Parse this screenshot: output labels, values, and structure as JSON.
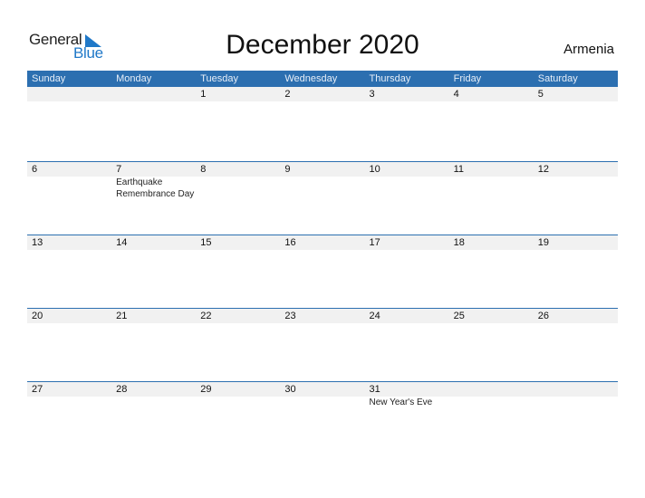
{
  "logo": {
    "word1": "General",
    "word2": "Blue"
  },
  "title": "December 2020",
  "country": "Armenia",
  "colors": {
    "header_bg": "#2c6fb0",
    "brand_blue": "#1f78c8",
    "band_bg": "#f1f1f1"
  },
  "weekdays": [
    "Sunday",
    "Monday",
    "Tuesday",
    "Wednesday",
    "Thursday",
    "Friday",
    "Saturday"
  ],
  "weeks": [
    [
      {
        "day": "",
        "event": ""
      },
      {
        "day": "",
        "event": ""
      },
      {
        "day": "1",
        "event": ""
      },
      {
        "day": "2",
        "event": ""
      },
      {
        "day": "3",
        "event": ""
      },
      {
        "day": "4",
        "event": ""
      },
      {
        "day": "5",
        "event": ""
      }
    ],
    [
      {
        "day": "6",
        "event": ""
      },
      {
        "day": "7",
        "event": "Earthquake Remembrance Day"
      },
      {
        "day": "8",
        "event": ""
      },
      {
        "day": "9",
        "event": ""
      },
      {
        "day": "10",
        "event": ""
      },
      {
        "day": "11",
        "event": ""
      },
      {
        "day": "12",
        "event": ""
      }
    ],
    [
      {
        "day": "13",
        "event": ""
      },
      {
        "day": "14",
        "event": ""
      },
      {
        "day": "15",
        "event": ""
      },
      {
        "day": "16",
        "event": ""
      },
      {
        "day": "17",
        "event": ""
      },
      {
        "day": "18",
        "event": ""
      },
      {
        "day": "19",
        "event": ""
      }
    ],
    [
      {
        "day": "20",
        "event": ""
      },
      {
        "day": "21",
        "event": ""
      },
      {
        "day": "22",
        "event": ""
      },
      {
        "day": "23",
        "event": ""
      },
      {
        "day": "24",
        "event": ""
      },
      {
        "day": "25",
        "event": ""
      },
      {
        "day": "26",
        "event": ""
      }
    ],
    [
      {
        "day": "27",
        "event": ""
      },
      {
        "day": "28",
        "event": ""
      },
      {
        "day": "29",
        "event": ""
      },
      {
        "day": "30",
        "event": ""
      },
      {
        "day": "31",
        "event": "New Year's Eve"
      },
      {
        "day": "",
        "event": ""
      },
      {
        "day": "",
        "event": ""
      }
    ]
  ]
}
